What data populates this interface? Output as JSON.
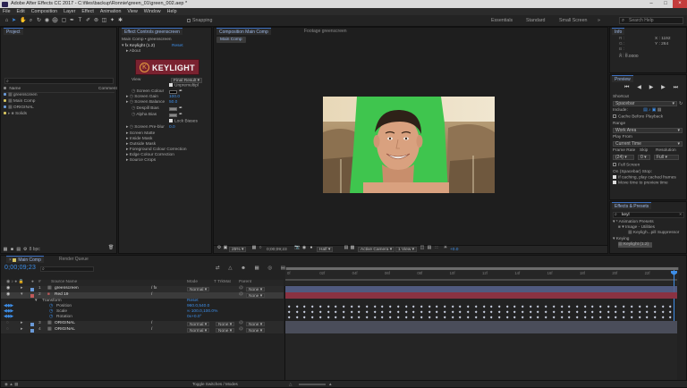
{
  "window": {
    "title": "Adobe After Effects CC 2017 - C:\\files\\backup\\Ronnie\\green_01\\green_002.aep *"
  },
  "menu": [
    "File",
    "Edit",
    "Composition",
    "Layer",
    "Effect",
    "Animation",
    "View",
    "Window",
    "Help"
  ],
  "toolbar": {
    "snapping": "Snapping",
    "workspaces": [
      "Essentials",
      "Standard",
      "Small Screen"
    ],
    "search_placeholder": "Search Help"
  },
  "project": {
    "tab": "Project",
    "search_placeholder": "",
    "col_name": "Name",
    "col_comment": "Comment",
    "items": [
      {
        "name": "greenscreen",
        "color": "#6a9ad8"
      },
      {
        "name": "Main Comp",
        "color": "#d6c460"
      },
      {
        "name": "ORIGINAL",
        "color": "#6a9ad8"
      },
      {
        "name": "Solids",
        "color": "#d6c460"
      }
    ],
    "bpc": "8 bpc"
  },
  "effect_controls": {
    "tab": "Effect Controls greenscreen",
    "path": "Main Comp • greenscreen",
    "effect": "Keylight (1.2)",
    "reset": "Reset",
    "about": "About",
    "logo": "KEYLIGHT",
    "view_label": "View",
    "view_value": "Final Result",
    "unpremult": "Unpremultipl",
    "props": [
      {
        "name": "Screen Colour",
        "value": ""
      },
      {
        "name": "Screen Gain",
        "value": "100.0"
      },
      {
        "name": "Screen Balance",
        "value": "50.0"
      },
      {
        "name": "Despill Bias",
        "value": ""
      },
      {
        "name": "Alpha Bias",
        "value": ""
      }
    ],
    "lock_biases": "Lock Biases",
    "prebar_label": "Screen Pre-blur",
    "prebar_value": "0.0",
    "groups": [
      "Screen Matte",
      "Inside Mask",
      "Outside Mask",
      "Foreground Colour Correction",
      "Edge Colour Correction",
      "Source Crops"
    ]
  },
  "comp": {
    "tab": "Composition Main Comp",
    "footage_tab": "Footage greenscreen",
    "sub_tab": "Main Comp",
    "zoom": "25%",
    "time": "0;00;09;23",
    "resolution": "Half",
    "camera": "Active Camera",
    "views": "1 View",
    "exposure": "+0.0"
  },
  "info": {
    "tab": "Info",
    "x": "X : 1192",
    "y": "Y : 264",
    "a": "A : 0.0000"
  },
  "preview": {
    "tab": "Preview",
    "shortcut_label": "Shortcut",
    "shortcut": "Spacebar",
    "include": "Include:",
    "cache": "Cache Before Playback",
    "range_label": "Range",
    "range": "Work Area",
    "play_from_label": "Play From",
    "play_from": "Current Time",
    "frame_rate_label": "Frame Rate",
    "skip_label": "Skip",
    "resolution_label": "Resolution",
    "frame_rate": "(24)",
    "skip": "0",
    "resolution": "Full",
    "full_screen": "Full Screen",
    "stop_label": "On (Spacebar) Stop:",
    "stop1": "If caching, play cached frames",
    "stop2": "Move time to preview time"
  },
  "effects_presets": {
    "tab": "Effects & Presets",
    "search": "keyl",
    "tree": [
      "▾ * Animation Presets",
      "▾ Image - Utilities",
      "Keyligh...pill Suppressor",
      "▾ Keying",
      "Keylight (1.2)"
    ]
  },
  "timeline": {
    "tab": "Main Comp",
    "render_tab": "Render Queue",
    "time": "0;00;09;23",
    "headers": {
      "source": "Source Name",
      "mode": "Mode",
      "trkmat": "TrkMat",
      "parent": "Parent"
    },
    "ruler": [
      "0f",
      "02f",
      "04f",
      "06f",
      "08f",
      "10f",
      "12f",
      "14f",
      "16f",
      "18f",
      "20f",
      "22f"
    ],
    "layers": [
      {
        "num": "1",
        "name": "greenscreen",
        "mode": "Normal",
        "trk": "",
        "parent": "None",
        "color": "#6a9ad8"
      },
      {
        "num": "2",
        "name": "Red 19",
        "mode": "",
        "trk": "",
        "parent": "None",
        "color": "#c05a5a"
      },
      {
        "num": "3",
        "name": "ORIGINAL",
        "mode": "Normal",
        "trk": "None",
        "parent": "None",
        "color": "#6a9ad8"
      },
      {
        "num": "4",
        "name": "ORIGINAL",
        "mode": "Normal",
        "trk": "None",
        "parent": "None",
        "color": "#6a9ad8"
      }
    ],
    "transform": {
      "label": "Transform",
      "reset": "Reset",
      "props": [
        {
          "name": "Position",
          "value": "960.0,540.0"
        },
        {
          "name": "Scale",
          "value": "∞ 100.0,100.0%"
        },
        {
          "name": "Rotation",
          "value": "0x+0.0°"
        }
      ]
    },
    "footer": "Toggle Switches / Modes"
  }
}
